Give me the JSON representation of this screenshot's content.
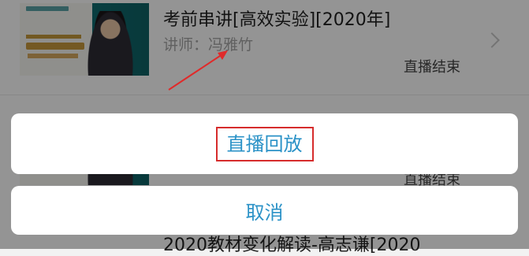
{
  "items": [
    {
      "title": "考前串讲[高效实验][2020年]",
      "teacher": "讲师：冯雅竹",
      "status": "直播结束"
    },
    {
      "title": "",
      "teacher": "",
      "status": "直播结束"
    },
    {
      "title": "2020教材变化解读-高志谦[2020",
      "teacher": "",
      "status": ""
    }
  ],
  "action_sheet": {
    "replay_label": "直播回放",
    "cancel_label": "取消"
  },
  "colors": {
    "accent": "#2b92c7",
    "highlight": "#d62c2c",
    "overlay": "rgba(0,0,0,0.42)"
  }
}
